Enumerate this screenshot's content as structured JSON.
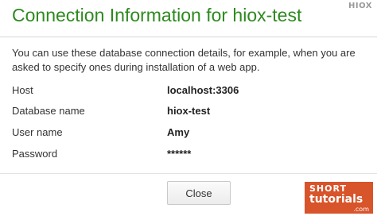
{
  "dialog": {
    "title": "Connection Information for hiox-test",
    "description": "You can use these database connection details, for example, when you are asked to specify ones during installation of a web app.",
    "rows": [
      {
        "label": "Host",
        "value": "localhost:3306"
      },
      {
        "label": "Database name",
        "value": "hiox-test"
      },
      {
        "label": "User name",
        "value": "Amy"
      },
      {
        "label": "Password",
        "value": "******"
      }
    ],
    "close_label": "Close"
  },
  "watermark": {
    "top_right": "HIOX",
    "badge_line1": "SHORT",
    "badge_line2": "tutorials",
    "badge_line3": ".com"
  },
  "colors": {
    "title": "#2e8a1f",
    "badge": "#d8542a"
  }
}
